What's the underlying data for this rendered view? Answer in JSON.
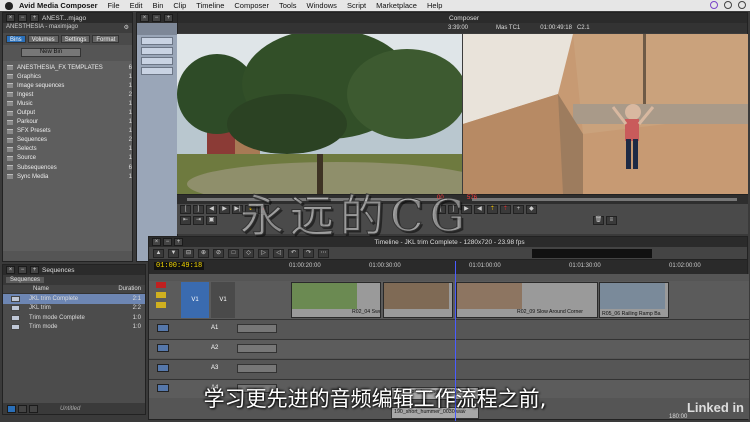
{
  "menubar": {
    "app": "Avid Media Composer",
    "items": [
      "File",
      "Edit",
      "Bin",
      "Clip",
      "Timeline",
      "Composer",
      "Tools",
      "Windows",
      "Script",
      "Marketplace",
      "Help"
    ]
  },
  "project": {
    "title": "ANEST...mjago",
    "subtitle": "ANESTHESIA - maximjago",
    "tabs": [
      "Bins",
      "Volumes",
      "Settings",
      "Format"
    ],
    "active_tab": "Bins",
    "new_bin": "New Bin",
    "bins": [
      {
        "name": "ANESTHESIA_FX TEMPLATES",
        "count": "6"
      },
      {
        "name": "Graphics",
        "count": "1"
      },
      {
        "name": "Image sequences",
        "count": "1"
      },
      {
        "name": "Ingest",
        "count": "2"
      },
      {
        "name": "Music",
        "count": "1"
      },
      {
        "name": "Output",
        "count": "1"
      },
      {
        "name": "Parkour",
        "count": "1"
      },
      {
        "name": "SFX Presets",
        "count": "1"
      },
      {
        "name": "Sequences",
        "count": "2"
      },
      {
        "name": "Selects",
        "count": "1"
      },
      {
        "name": "Source",
        "count": "1"
      },
      {
        "name": "Subsequences",
        "count": "6"
      },
      {
        "name": "Sync Media",
        "count": "1"
      }
    ]
  },
  "sequences": {
    "title": "Sequences",
    "tab": "Sequences",
    "col_name": "Name",
    "col_duration": "Duration",
    "rows": [
      {
        "name": "JKL trim Complete",
        "dur": "2:1"
      },
      {
        "name": "JKL trim",
        "dur": "2:2"
      },
      {
        "name": "Trim mode Complete",
        "dur": "1:0"
      },
      {
        "name": "Trim mode",
        "dur": "1:0"
      }
    ],
    "footer": "Untitled"
  },
  "composer": {
    "title": "Composer",
    "left_tc": "3:39:00",
    "mas_tc_label": "Mas TC1",
    "mas_tc": "01:00:49:18",
    "track": "C2.1",
    "in_tc": "00",
    "out_tc": "576"
  },
  "timeline": {
    "title": "Timeline - JKL trim Complete - 1280x720 - 23.98 fps",
    "position_tc": "01:00:49:18",
    "ruler": [
      "01:00:20:00",
      "01:00:30:00",
      "01:01:00:00",
      "01:01:30:00",
      "01:02:00:00"
    ],
    "tracks": [
      "V1",
      "A1",
      "A2",
      "A3",
      "A4"
    ],
    "clips": [
      "R02_04 Swo Accross Pond",
      "R02_09 Slow Around Corner",
      "R05_06 Railing Ramp Ba"
    ],
    "audio_clips": [
      "190_short_hummer_0030.wav",
      "190_short_hummer_0030.wav"
    ],
    "bottom_time": "180:00"
  },
  "watermark": "永远的CG",
  "subtitle": "学习更先进的音频编辑工作流程之前,",
  "brand": "Linked in"
}
